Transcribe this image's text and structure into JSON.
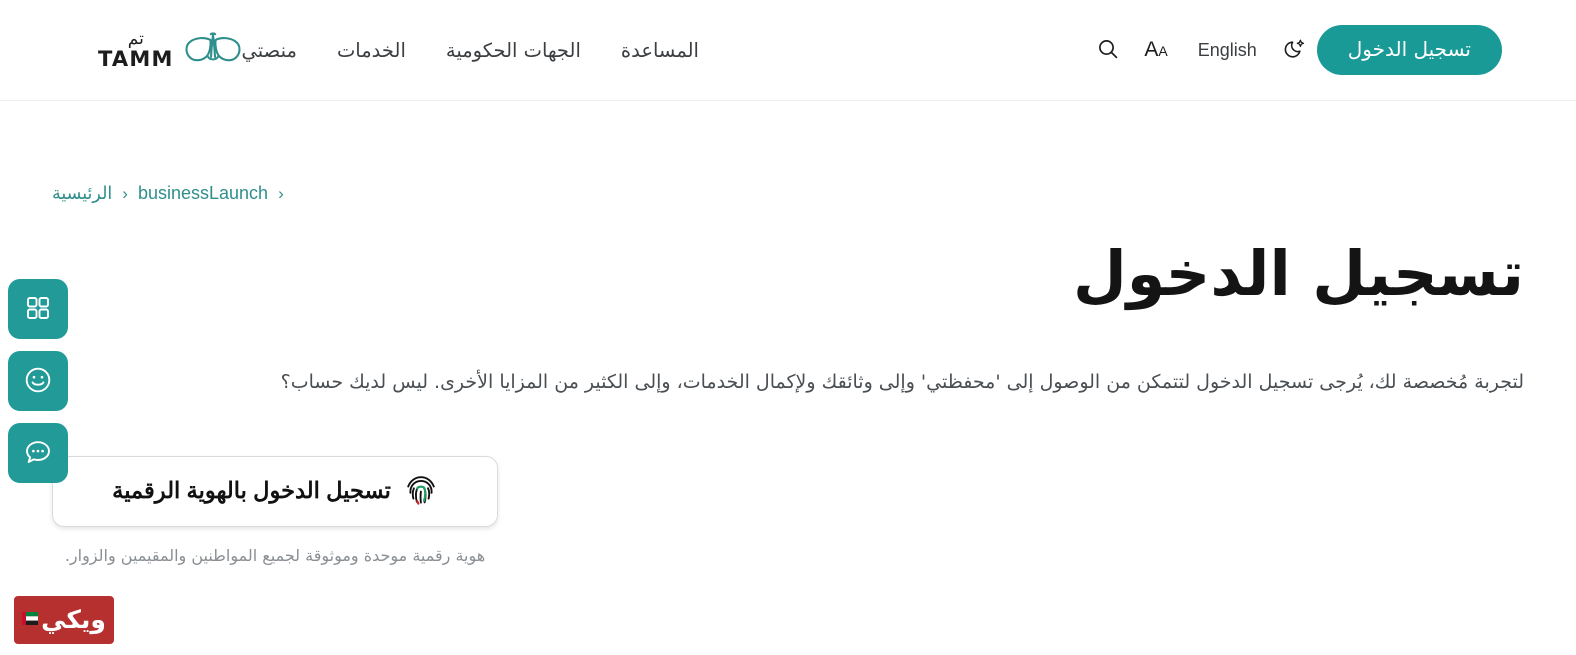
{
  "brand": {
    "accent_teal": "#199a96",
    "logo_arabic": "تم",
    "logo_latin": "TAMM",
    "logo_mark_icon": "tamm-wings-logo-icon"
  },
  "header": {
    "nav_items": [
      {
        "label": "منصتي",
        "name": "nav-item-my-platform"
      },
      {
        "label": "الخدمات",
        "name": "nav-item-services"
      },
      {
        "label": "الجهات الحكومية",
        "name": "nav-item-government-entities"
      },
      {
        "label": "المساعدة",
        "name": "nav-item-help"
      }
    ],
    "search_icon": "search-icon",
    "font_size_small": "A",
    "font_size_large": "A",
    "language_toggle": "English",
    "dark_mode_icon": "moon-star-icon",
    "login_button": "تسجيل الدخول"
  },
  "breadcrumb": {
    "items": [
      {
        "label": "الرئيسية",
        "name": "breadcrumb-home"
      },
      {
        "label": "businessLaunch",
        "name": "breadcrumb-business-launch"
      }
    ],
    "separator": "‹"
  },
  "main": {
    "title": "تسجيل الدخول",
    "intro": "لتجربة مُخصصة لك، يُرجى تسجيل الدخول لتتمكن من الوصول إلى 'محفظتي' وإلى وثائقك ولإكمال الخدمات، وإلى الكثير من المزايا الأخرى. ليس لديك حساب؟",
    "cta_button_label": "تسجيل الدخول بالهوية الرقمية",
    "cta_icon": "uae-pass-fingerprint-icon",
    "cta_note": "هوية رقمية موحدة وموثوقة لجميع المواطنين والمقيمين والزوار."
  },
  "side_rail": {
    "buttons": [
      {
        "name": "rail-apps-grid-button",
        "icon": "grid-apps-icon"
      },
      {
        "name": "rail-feedback-button",
        "icon": "smiley-face-icon"
      },
      {
        "name": "rail-chat-button",
        "icon": "chat-bubble-icon"
      }
    ]
  },
  "watermark": {
    "text": "ويكي",
    "icon": "uae-flag-icon",
    "background": "#b5302f"
  }
}
